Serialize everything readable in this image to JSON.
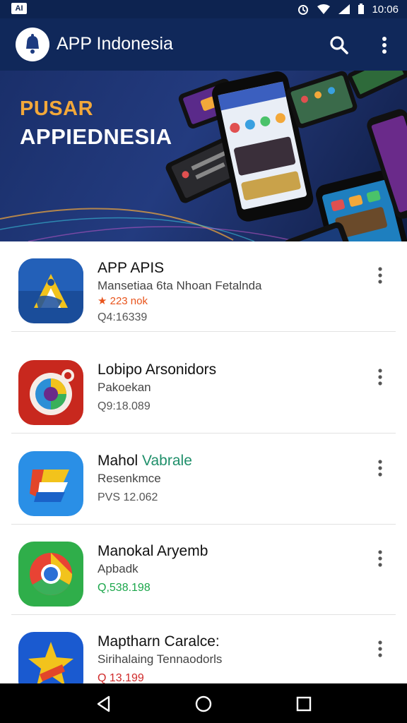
{
  "status": {
    "badge": "AI",
    "time": "10:06"
  },
  "appbar": {
    "title": "APP Indonesia",
    "logo": "bell-logo-icon",
    "search_icon": "search-icon",
    "more_icon": "more-vert-icon"
  },
  "banner": {
    "line1": "PUSAR",
    "line2": "APPIEDNESIA"
  },
  "apps": [
    {
      "name": "APP APIS",
      "subtitle": "Mansetiaa 6ta Nhoan Fetalnda",
      "rating": "★ 223 nok",
      "meta": "Q4:16339",
      "icon": "app-apis-icon"
    },
    {
      "name": "Lobipo Arsonidors",
      "subtitle": "Pakoekan",
      "meta": "Q9:18.089",
      "icon": "lobipo-icon"
    },
    {
      "name_a": "Mahol",
      "name_b": "Vabrale",
      "subtitle": "Resenkmce",
      "meta": "PVS 12.062",
      "icon": "mahol-icon"
    },
    {
      "name": "Manokal Aryemb",
      "subtitle": "Apbadk",
      "meta": "Q,538.198",
      "icon": "chrome-style-icon"
    },
    {
      "name": "Maptharn Caralce:",
      "subtitle": "Sirihalaing Tennaodorls",
      "meta": "Q 13.199",
      "icon": "star-app-icon"
    }
  ],
  "colors": {
    "appbar": "#10285a",
    "statusbar": "#0d2350",
    "banner_accent": "#f3a83a",
    "rating": "#e8541c",
    "meta_green": "#1aa64a",
    "name_green": "#1f8f6a"
  },
  "nav": {
    "back_icon": "back-icon",
    "home_icon": "home-icon",
    "recents_icon": "recents-icon"
  }
}
